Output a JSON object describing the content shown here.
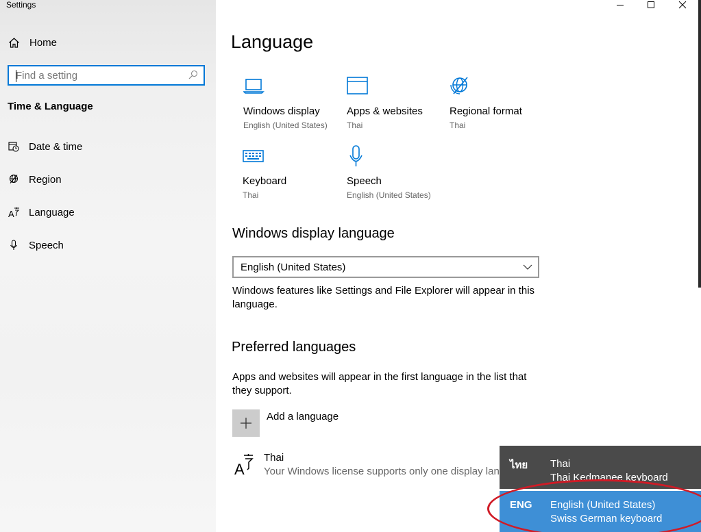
{
  "window": {
    "title": "Settings"
  },
  "sidebar": {
    "home_label": "Home",
    "search_placeholder": "Find a setting",
    "section_heading": "Time & Language",
    "items": [
      {
        "label": "Date & time",
        "icon": "calendar-clock-icon"
      },
      {
        "label": "Region",
        "icon": "globe-icon"
      },
      {
        "label": "Language",
        "icon": "language-icon"
      },
      {
        "label": "Speech",
        "icon": "microphone-icon"
      }
    ]
  },
  "main": {
    "title": "Language",
    "tiles": [
      {
        "label": "Windows display",
        "sub": "English (United States)",
        "icon": "laptop-icon"
      },
      {
        "label": "Apps & websites",
        "sub": "Thai",
        "icon": "browser-window-icon"
      },
      {
        "label": "Regional format",
        "sub": "Thai",
        "icon": "globe-icon"
      },
      {
        "label": "Keyboard",
        "sub": "Thai",
        "icon": "keyboard-icon"
      },
      {
        "label": "Speech",
        "sub": "English (United States)",
        "icon": "microphone-icon"
      }
    ],
    "display_language": {
      "heading": "Windows display language",
      "selected": "English (United States)",
      "description": "Windows features like Settings and File Explorer will appear in this language."
    },
    "preferred": {
      "heading": "Preferred languages",
      "description": "Apps and websites will appear in the first language in the list that they support.",
      "add_label": "Add a language",
      "languages": [
        {
          "name": "Thai",
          "note": "Your Windows license supports only one display language."
        }
      ]
    }
  },
  "flyout": {
    "items": [
      {
        "code": "ไทย",
        "name": "Thai",
        "keyboard": "Thai Kedmanee keyboard"
      },
      {
        "code": "ENG",
        "name": "English (United States)",
        "keyboard": "Swiss German keyboard"
      }
    ]
  },
  "colors": {
    "accent": "#0078d7",
    "flyout_selected": "#3e8fd6",
    "flyout_bg": "#4a4a4a",
    "annotation": "#d01b26"
  }
}
